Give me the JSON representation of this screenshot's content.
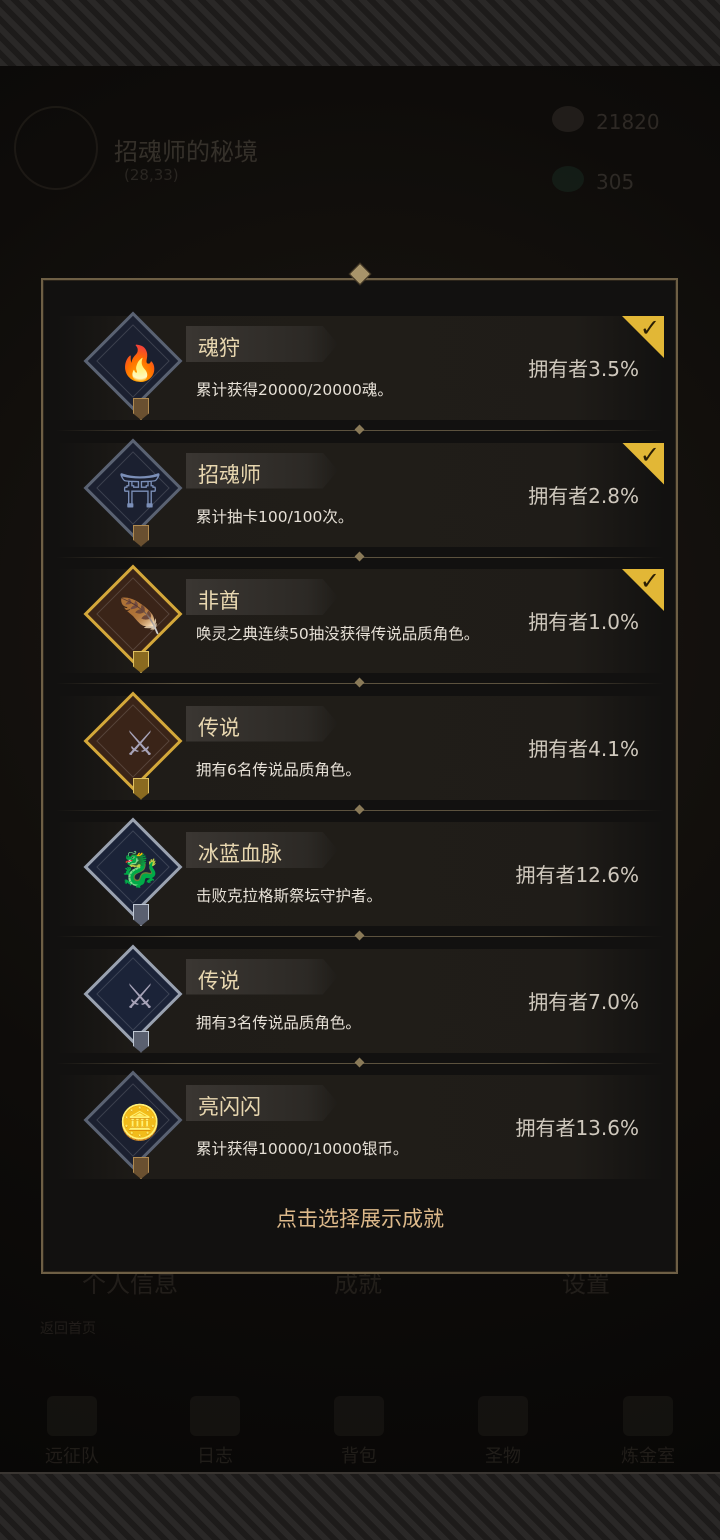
{
  "background": {
    "area_title": "招魂师的秘境",
    "area_coords": "(28,33)",
    "resource_1": "21820",
    "resource_2": "305",
    "tabs": [
      "个人信息",
      "成就",
      "设置"
    ],
    "back_text": "返回首页",
    "nav": [
      "远征队",
      "日志",
      "背包",
      "圣物",
      "炼金室"
    ]
  },
  "achievements": [
    {
      "name": "魂狩",
      "desc": "累计获得20000/20000魂。",
      "owners": "拥有者3.5%",
      "completed": true,
      "frame": "silver-dark",
      "icon": "blue-flame-icon"
    },
    {
      "name": "招魂师",
      "desc": "累计抽卡100/100次。",
      "owners": "拥有者2.8%",
      "completed": true,
      "frame": "silver-dark",
      "icon": "summon-altar-icon"
    },
    {
      "name": "非酋",
      "desc": "唤灵之典连续50抽没获得传说品质角色。",
      "owners": "拥有者1.0%",
      "completed": true,
      "frame": "gold",
      "icon": "feathered-warrior-icon"
    },
    {
      "name": "传说",
      "desc": "拥有6名传说品质角色。",
      "owners": "拥有者4.1%",
      "completed": false,
      "frame": "gold",
      "icon": "armored-knight-icon"
    },
    {
      "name": "冰蓝血脉",
      "desc": "击败克拉格斯祭坛守护者。",
      "owners": "拥有者12.6%",
      "completed": false,
      "frame": "silver",
      "icon": "ice-dragon-icon"
    },
    {
      "name": "传说",
      "desc": "拥有3名传说品质角色。",
      "owners": "拥有者7.0%",
      "completed": false,
      "frame": "silver",
      "icon": "armored-knight-icon"
    },
    {
      "name": "亮闪闪",
      "desc": "累计获得10000/10000银币。",
      "owners": "拥有者13.6%",
      "completed": false,
      "frame": "silver-dark",
      "icon": "silver-coins-icon"
    }
  ],
  "hint": "点击选择展示成就"
}
